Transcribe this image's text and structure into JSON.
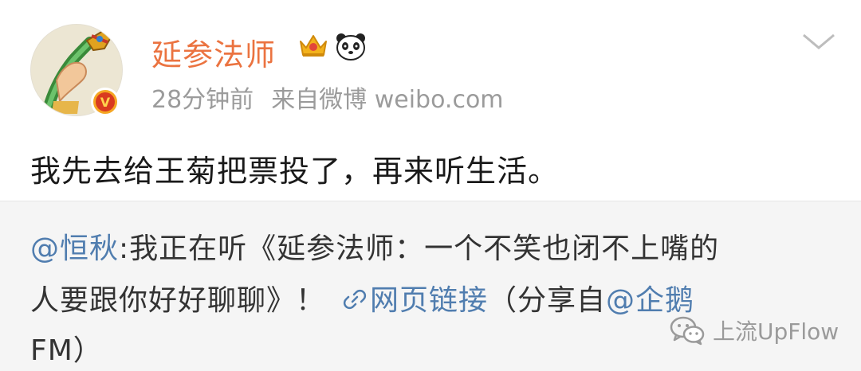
{
  "post": {
    "username": "延参法师",
    "timestamp": "28分钟前",
    "source": "来自微博 weibo.com",
    "content": "我先去给王菊把票投了，再来听生活。",
    "verified_badge": "V",
    "icons": {
      "crown": "crown-icon",
      "panda": "panda-icon",
      "more": "chevron-down-icon",
      "link": "link-icon",
      "wechat": "wechat-icon"
    }
  },
  "repost": {
    "mention": "@恒秋",
    "text_part1": ":我正在听《延参法师：一个不笑也闭不上嘴的",
    "text_part2": "人要跟你好好聊聊》！",
    "link_label": "网页链接",
    "share_prefix": "（分享自",
    "share_mention": "@企鹅",
    "share_suffix": "FM）"
  },
  "watermark": {
    "text": "上流UpFlow"
  },
  "colors": {
    "username": "#eb7340",
    "link": "#507daf",
    "meta": "#9b9b9b",
    "repost_bg": "#f5f5f5"
  }
}
